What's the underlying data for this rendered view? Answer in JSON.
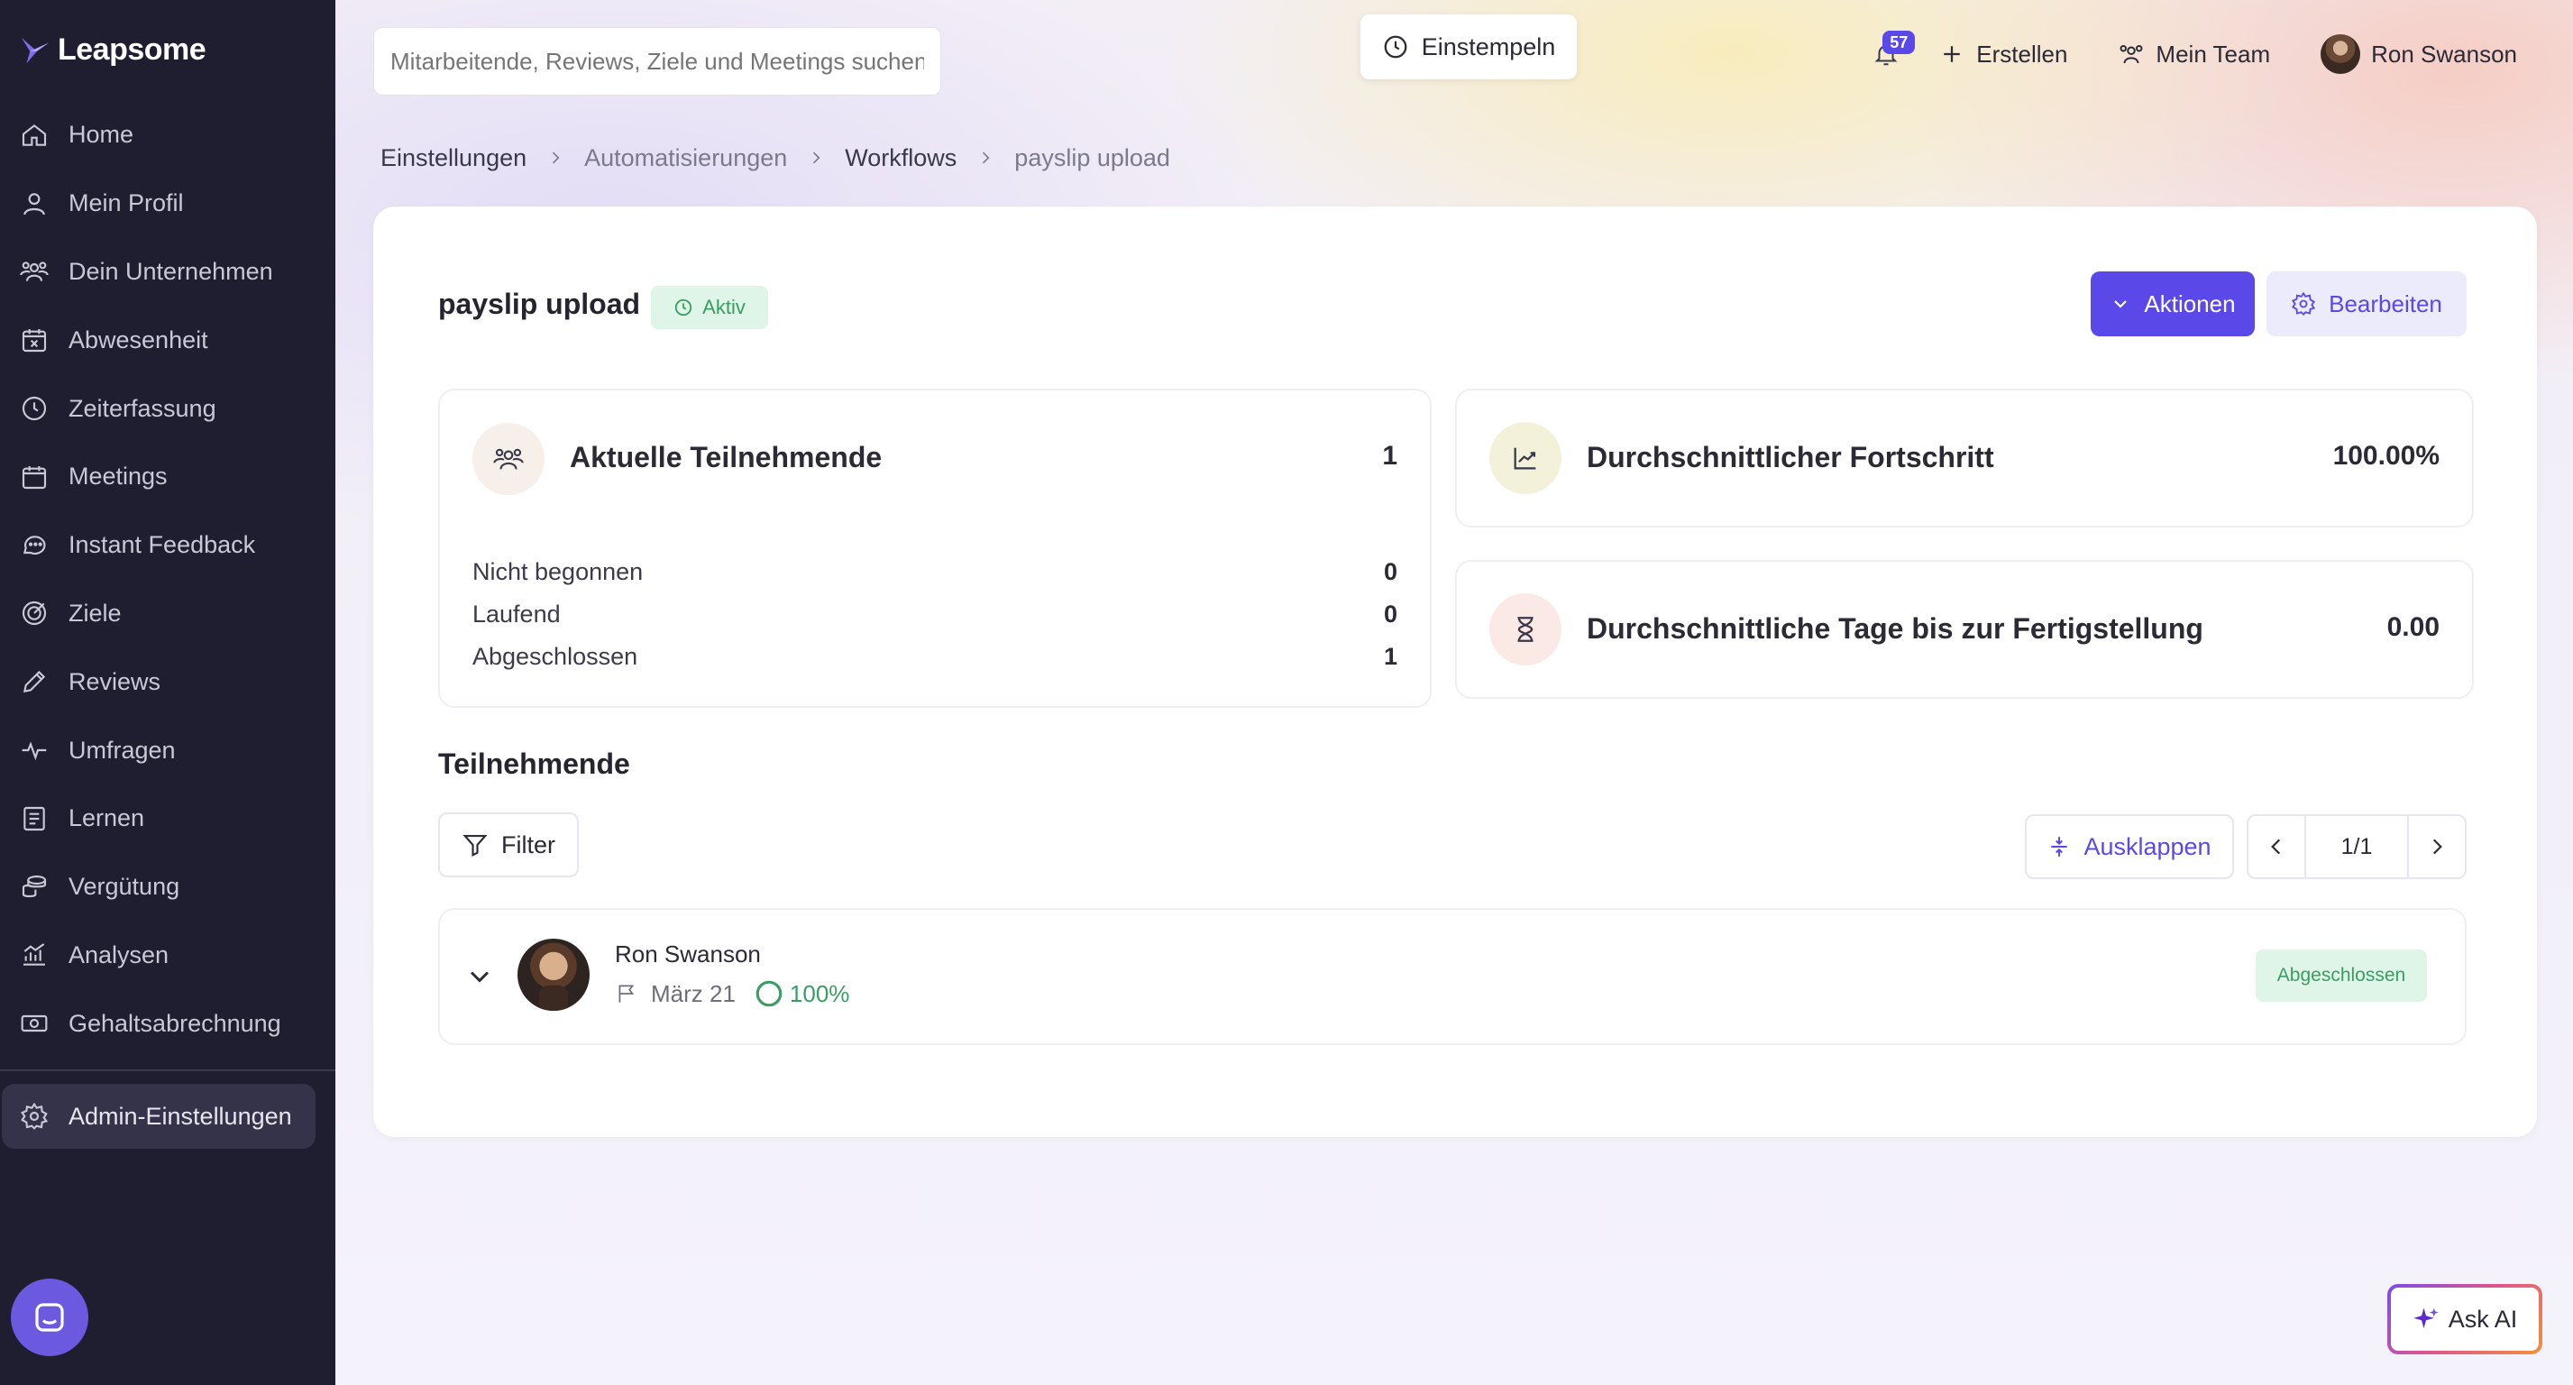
{
  "app": {
    "name": "Leapsome"
  },
  "sidebar": {
    "items": [
      {
        "label": "Home",
        "icon": "home-icon"
      },
      {
        "label": "Mein Profil",
        "icon": "user-icon"
      },
      {
        "label": "Dein Unternehmen",
        "icon": "people-icon"
      },
      {
        "label": "Abwesenheit",
        "icon": "calendar-x-icon"
      },
      {
        "label": "Zeiterfassung",
        "icon": "clock-icon"
      },
      {
        "label": "Meetings",
        "icon": "calendar-icon"
      },
      {
        "label": "Instant Feedback",
        "icon": "chat-icon"
      },
      {
        "label": "Ziele",
        "icon": "target-icon"
      },
      {
        "label": "Reviews",
        "icon": "pen-icon"
      },
      {
        "label": "Umfragen",
        "icon": "pulse-icon"
      },
      {
        "label": "Lernen",
        "icon": "book-icon"
      },
      {
        "label": "Vergütung",
        "icon": "coins-icon"
      },
      {
        "label": "Analysen",
        "icon": "chart-icon"
      },
      {
        "label": "Gehaltsabrechnung",
        "icon": "cash-icon"
      }
    ],
    "admin": {
      "label": "Admin-Einstellungen",
      "icon": "gear-icon"
    }
  },
  "topbar": {
    "search_placeholder": "Mitarbeitende, Reviews, Ziele und Meetings suchen",
    "clock_in": "Einstempeln",
    "notifications_count": "57",
    "create": "Erstellen",
    "my_team": "Mein Team",
    "user_name": "Ron Swanson"
  },
  "breadcrumb": [
    "Einstellungen",
    "Automatisierungen",
    "Workflows",
    "payslip upload"
  ],
  "workflow": {
    "title": "payslip upload",
    "status": "Aktiv",
    "actions_label": "Aktionen",
    "edit_label": "Bearbeiten"
  },
  "stats": {
    "participants": {
      "title": "Aktuelle Teilnehmende",
      "value": "1",
      "rows": [
        {
          "label": "Nicht begonnen",
          "value": "0"
        },
        {
          "label": "Laufend",
          "value": "0"
        },
        {
          "label": "Abgeschlossen",
          "value": "1"
        }
      ]
    },
    "progress": {
      "title": "Durchschnittlicher Fortschritt",
      "value": "100.00%"
    },
    "days": {
      "title": "Durchschnittliche Tage bis zur Fertigstellung",
      "value": "0.00"
    }
  },
  "participants_section": {
    "title": "Teilnehmende",
    "filter_label": "Filter",
    "expand_label": "Ausklappen",
    "page": "1/1",
    "items": [
      {
        "name": "Ron Swanson",
        "date": "März 21",
        "progress": "100%",
        "progress_value": 1.0,
        "status": "Abgeschlossen"
      }
    ]
  },
  "ask_ai": "Ask AI",
  "colors": {
    "sidebar_bg": "#1f1e30",
    "primary": "#5b48e8",
    "success": "#3a9d65",
    "success_bg": "#dff5e7"
  }
}
